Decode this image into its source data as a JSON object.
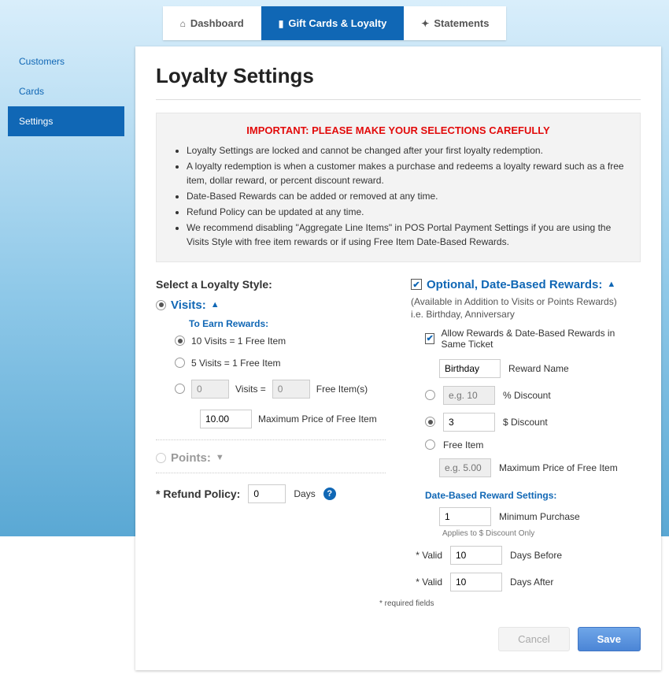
{
  "topnav": {
    "dashboard": "Dashboard",
    "gcloyalty": "Gift Cards & Loyalty",
    "statements": "Statements"
  },
  "sidebar": {
    "customers": "Customers",
    "cards": "Cards",
    "settings": "Settings"
  },
  "title": "Loyalty Settings",
  "alert": {
    "heading": "IMPORTANT: PLEASE MAKE YOUR SELECTIONS CAREFULLY",
    "b1": "Loyalty Settings are locked and cannot be changed after your first loyalty redemption.",
    "b2": "A loyalty redemption is when a customer makes a purchase and redeems a loyalty reward such as a free item, dollar reward, or percent discount reward.",
    "b3": "Date-Based Rewards can be added or removed at any time.",
    "b4": "Refund Policy can be updated at any time.",
    "b5": "We recommend disabling \"Aggregate Line Items\" in POS Portal Payment Settings if you are using the Visits Style with free item rewards or if using Free Item Date-Based Rewards."
  },
  "left": {
    "select_label": "Select a Loyalty Style:",
    "visits_label": "Visits:",
    "earn_label": "To Earn Rewards:",
    "opt1": "10 Visits = 1 Free Item",
    "opt2": "5 Visits = 1 Free Item",
    "custom_visits_val": "0",
    "custom_visits_mid": "Visits =",
    "custom_free_val": "0",
    "custom_free_suffix": "Free Item(s)",
    "max_price_val": "10.00",
    "max_price_label": "Maximum Price of Free Item",
    "points_label": "Points:",
    "refund_label": "* Refund Policy:",
    "refund_val": "0",
    "refund_suffix": "Days"
  },
  "right": {
    "head": "Optional, Date-Based Rewards:",
    "avail": "(Available in Addition to Visits or Points Rewards)",
    "eg": "i.e. Birthday, Anniversary",
    "allow_same": "Allow Rewards & Date-Based Rewards in Same Ticket",
    "reward_name_val": "Birthday",
    "reward_name_lbl": "Reward Name",
    "pct_ph": "e.g. 10",
    "pct_lbl": "% Discount",
    "dollar_val": "3",
    "dollar_lbl": "$ Discount",
    "freeitem_lbl": "Free Item",
    "freeitem_ph": "e.g. 5.00",
    "freeitem_max": "Maximum Price of Free Item",
    "settings_head": "Date-Based Reward Settings:",
    "min_val": "1",
    "min_lbl": "Minimum Purchase",
    "min_note": "Applies to $ Discount Only",
    "before_lbl": "* Valid",
    "before_val": "10",
    "before_suffix": "Days Before",
    "after_lbl": "* Valid",
    "after_val": "10",
    "after_suffix": "Days After",
    "req": "* required fields"
  },
  "footer": {
    "cancel": "Cancel",
    "save": "Save"
  }
}
